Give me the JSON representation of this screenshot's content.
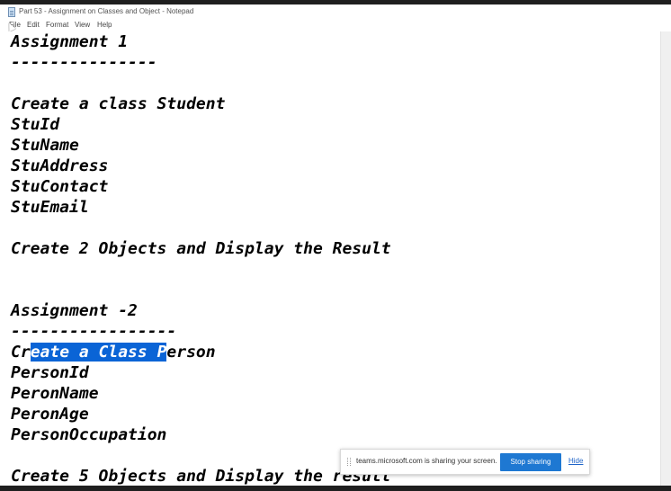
{
  "window": {
    "title": "Part 53 - Assignment on Classes and Object - Notepad"
  },
  "menu": {
    "items": [
      "File",
      "Edit",
      "Format",
      "View",
      "Help"
    ]
  },
  "editor": {
    "lines": [
      "Assignment 1",
      "---------------",
      "",
      "Create a class Student",
      "StuId",
      "StuName",
      "StuAddress",
      "StuContact",
      "StuEmail",
      "",
      "Create 2 Objects and Display the Result",
      "",
      "",
      "Assignment -2",
      "-----------------",
      "",
      "PersonId",
      "PeronName",
      "PeronAge",
      "PersonOccupation",
      "",
      "Create 5 Objects and Display the result"
    ],
    "selected_line": {
      "before": "Cr",
      "selected": "eate a Class P",
      "after": "erson"
    }
  },
  "share_bar": {
    "message": "teams.microsoft.com is sharing your screen.",
    "stop_label": "Stop sharing",
    "hide_label": "Hide"
  },
  "colors": {
    "selection": "#0a64d6",
    "stop_button": "#1e78d2",
    "hide_link": "#1e64c8"
  }
}
